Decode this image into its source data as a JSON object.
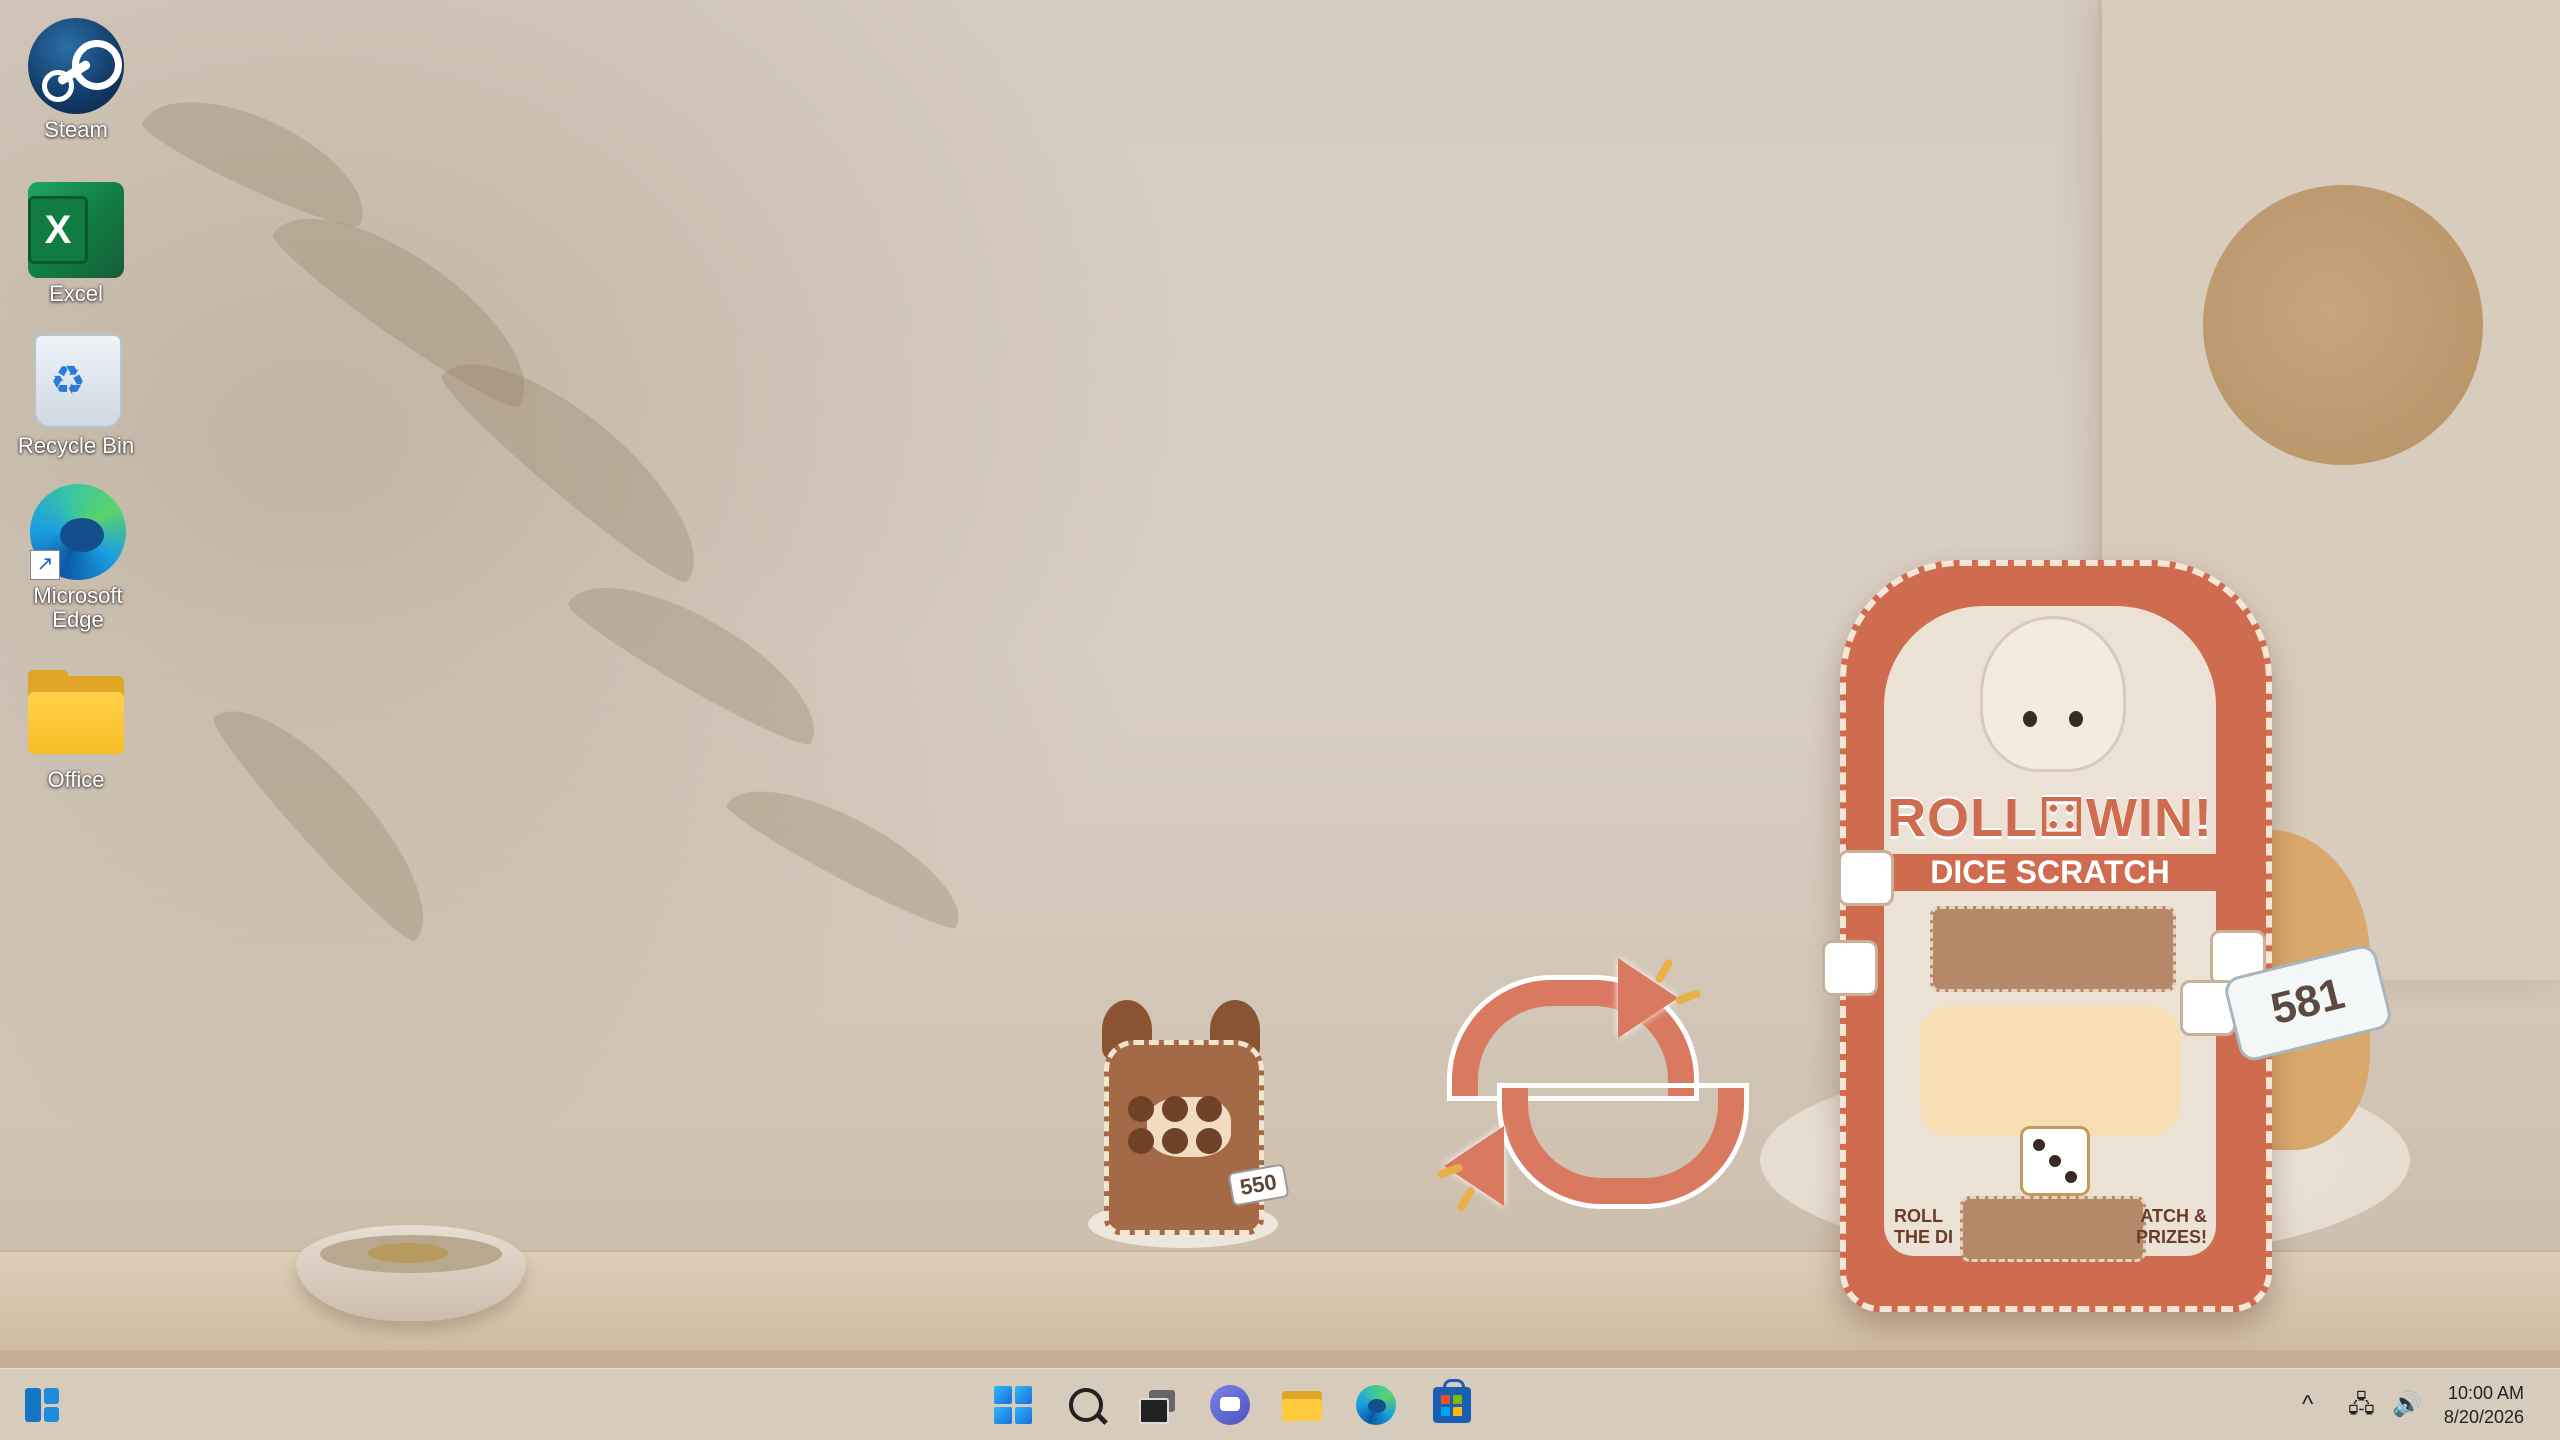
{
  "desktop_icons": [
    {
      "label": "Steam",
      "icon": "steam-icon"
    },
    {
      "label": "Excel",
      "icon": "excel-icon",
      "glyph": "X"
    },
    {
      "label": "Recycle Bin",
      "icon": "recycle-bin-icon"
    },
    {
      "label": "Microsoft Edge",
      "icon": "edge-icon"
    },
    {
      "label": "Office",
      "icon": "folder-icon"
    }
  ],
  "widgets": {
    "small_sticker": {
      "tag": "550"
    },
    "large_sticker": {
      "title": "ROLL⚃WIN!",
      "subtitle": "DICE SCRATCH",
      "footer_left": "ROLL\nTHE DI",
      "footer_right": "ATCH &\nPRIZES!",
      "bottle_number": "581"
    }
  },
  "taskbar": {
    "items": [
      "widgets-icon",
      "start-icon",
      "search-icon",
      "task-view-icon",
      "chat-icon",
      "file-explorer-icon",
      "edge-icon",
      "store-icon"
    ],
    "tray": {
      "chevron": "^",
      "network": "network-icon",
      "volume": "volume-icon"
    },
    "time": "10:00 AM",
    "date": "8/20/2026"
  },
  "colors": {
    "wallpaper": "#d6ccbf",
    "accent_card": "#cf6c4f",
    "taskbar": "#d8cdbe"
  }
}
